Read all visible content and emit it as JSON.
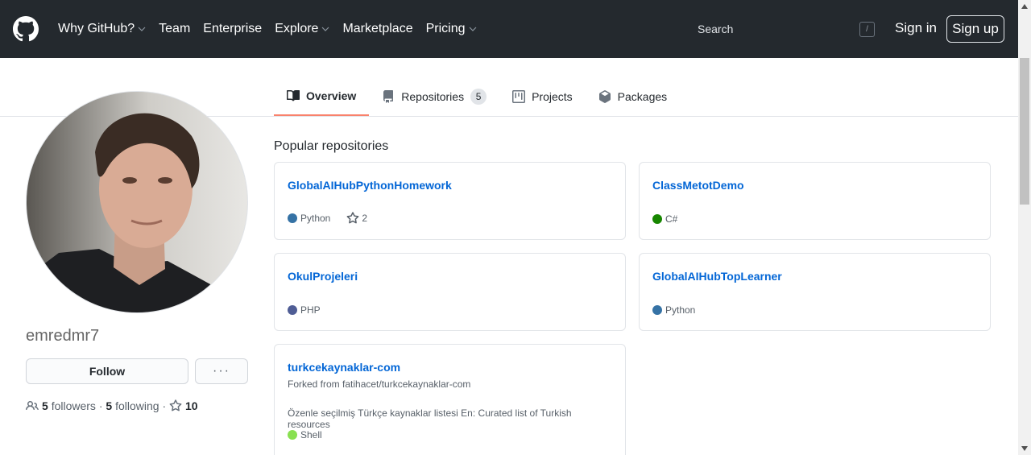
{
  "header": {
    "nav": [
      {
        "label": "Why GitHub?",
        "caret": true
      },
      {
        "label": "Team",
        "caret": false
      },
      {
        "label": "Enterprise",
        "caret": false
      },
      {
        "label": "Explore",
        "caret": true
      },
      {
        "label": "Marketplace",
        "caret": false
      },
      {
        "label": "Pricing",
        "caret": true
      }
    ],
    "search_placeholder": "Search",
    "search_shortcut": "/",
    "signin_label": "Sign in",
    "signup_label": "Sign up"
  },
  "tabs": [
    {
      "label": "Overview",
      "icon": "book-icon",
      "active": true
    },
    {
      "label": "Repositories",
      "icon": "repo-icon",
      "counter": "5"
    },
    {
      "label": "Projects",
      "icon": "project-icon"
    },
    {
      "label": "Packages",
      "icon": "package-icon"
    }
  ],
  "profile": {
    "username": "emredmr7",
    "follow_label": "Follow",
    "more_label": "···",
    "followers_count": "5",
    "followers_label": "followers",
    "separator": "·",
    "following_count": "5",
    "following_label": "following",
    "stars_count": "10"
  },
  "popular": {
    "title": "Popular repositories",
    "repos": [
      {
        "name": "GlobalAIHubPythonHomework",
        "language": "Python",
        "lang_color": "#3572A5",
        "stars": "2"
      },
      {
        "name": "ClassMetotDemo",
        "language": "C#",
        "lang_color": "#178600"
      },
      {
        "name": "OkulProjeleri",
        "language": "PHP",
        "lang_color": "#4F5D95"
      },
      {
        "name": "GlobalAIHubTopLearner",
        "language": "Python",
        "lang_color": "#3572A5"
      },
      {
        "name": "turkcekaynaklar-com",
        "forked_from": "Forked from fatihacet/turkcekaynaklar-com",
        "description": "Özenle seçilmiş Türkçe kaynaklar listesi En: Curated list of Turkish resources",
        "language": "Shell",
        "lang_color": "#89e051"
      }
    ]
  },
  "colors": {
    "header_bg": "#24292e",
    "link": "#0366d6",
    "tab_active_underline": "#f9826c"
  }
}
